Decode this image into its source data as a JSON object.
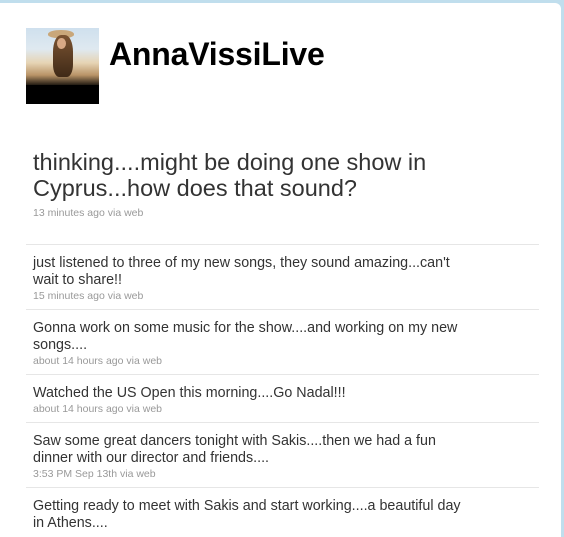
{
  "profile": {
    "screen_name": "AnnaVissiLive"
  },
  "latest_status": {
    "text": "thinking....might be doing one show in Cyprus...how does that sound?",
    "time": "13 minutes ago",
    "via": "via web"
  },
  "timeline": [
    {
      "text": "just listened to three of my new songs, they sound amazing...can't wait to share!!",
      "time": "15 minutes ago",
      "via": "via web"
    },
    {
      "text": "Gonna work on some music for the show....and working on my new songs....",
      "time": "about 14 hours ago",
      "via": "via web"
    },
    {
      "text": "Watched the US Open this morning....Go Nadal!!!",
      "time": "about 14 hours ago",
      "via": "via web"
    },
    {
      "text": "Saw some great dancers tonight with Sakis....then we had a fun dinner with our director and friends....",
      "time": "3:53 PM Sep 13th",
      "via": "via web"
    },
    {
      "text": "Getting ready to meet with Sakis and start working....a beautiful day in Athens....",
      "time": "",
      "via": ""
    }
  ]
}
